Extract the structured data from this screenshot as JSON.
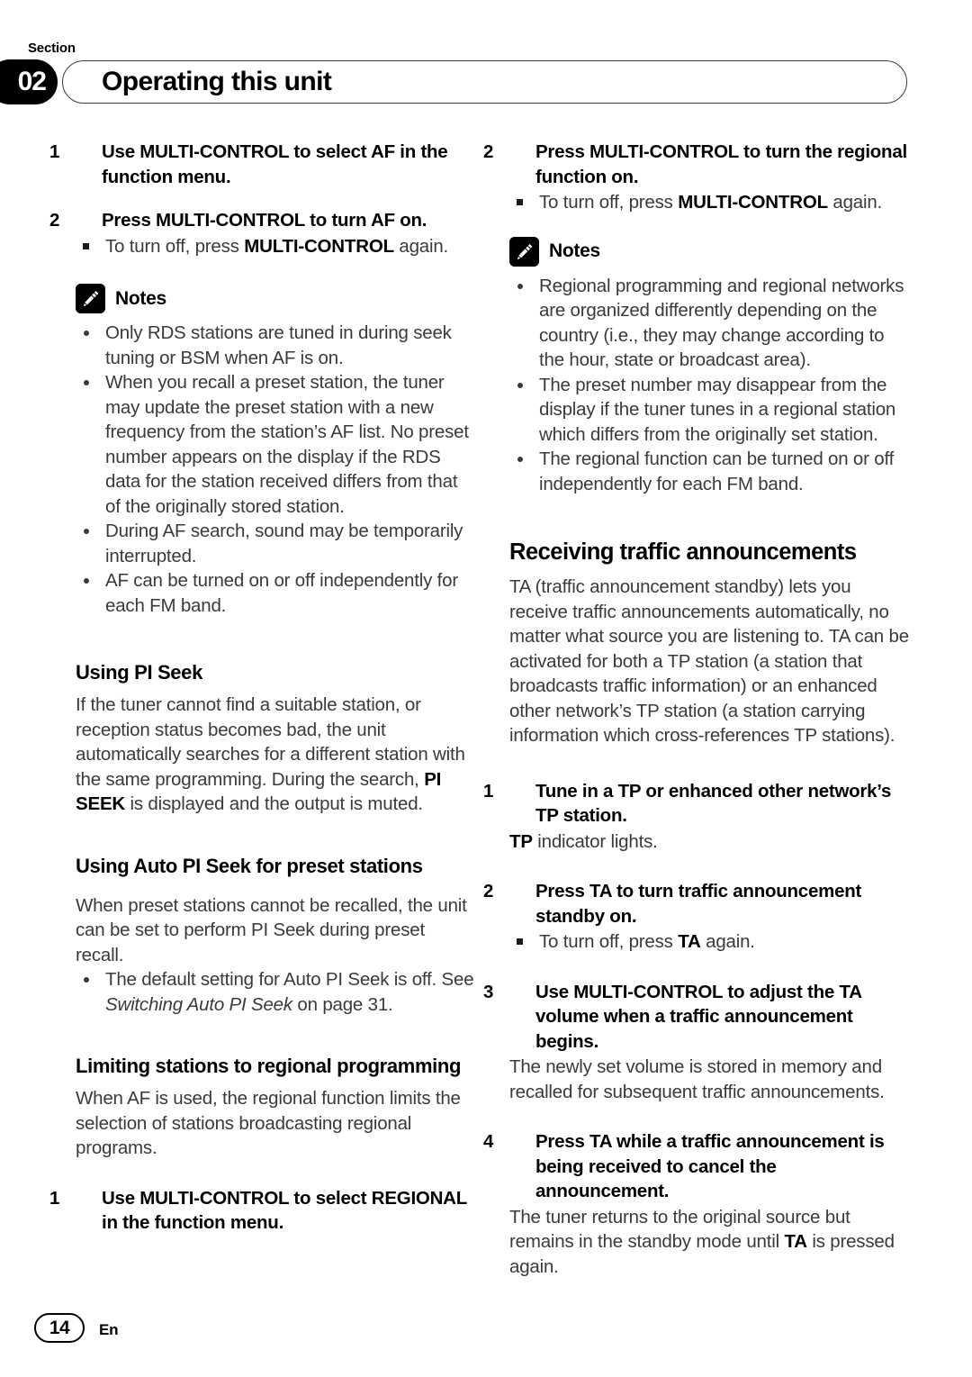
{
  "header": {
    "section_label": "Section",
    "section_number": "02",
    "title": "Operating this unit"
  },
  "footer": {
    "page_number": "14",
    "language_code": "En"
  },
  "icons": {
    "notes": "pencil-note-icon"
  },
  "left_column": {
    "step_af_1_num": "1",
    "step_af_1_text": "Use MULTI-CONTROL to select AF in the function menu.",
    "step_af_2_num": "2",
    "step_af_2_text": "Press MULTI-CONTROL to turn AF on.",
    "step_af_2_subbullet_pre": "To turn off, press ",
    "step_af_2_subbullet_bold": "MULTI-CONTROL",
    "step_af_2_subbullet_post": " again.",
    "notes_label": "Notes",
    "notes": [
      "Only RDS stations are tuned in during seek tuning or BSM when AF is on.",
      "When you recall a preset station, the tuner may update the preset station with a new frequency from the station’s AF list. No preset number appears on the display if the RDS data for the station received differs from that of the originally stored station.",
      "During AF search, sound may be temporarily interrupted.",
      "AF can be turned on or off independently for each FM band."
    ],
    "heading_pi_seek": "Using PI Seek",
    "pi_seek_body_pre": "If the tuner cannot find a suitable station, or reception status becomes bad, the unit automatically searches for a different station with the same programming. During the search, ",
    "pi_seek_body_bold": "PI SEEK",
    "pi_seek_body_post": " is displayed and the output is muted.",
    "heading_auto_pi_seek": "Using Auto PI Seek for preset stations",
    "auto_pi_seek_body": "When preset stations cannot be recalled, the unit can be set to perform PI Seek during preset recall.",
    "auto_pi_seek_note_pre": "The default setting for Auto PI Seek is off. See ",
    "auto_pi_seek_note_italic": "Switching Auto PI Seek",
    "auto_pi_seek_note_post": " on page 31.",
    "heading_limiting": "Limiting stations to regional programming",
    "limiting_body": "When AF is used, the regional function limits the selection of stations broadcasting regional programs.",
    "step_reg_1_num": "1",
    "step_reg_1_text": "Use MULTI-CONTROL to select REGIONAL in the function menu."
  },
  "right_column": {
    "step_reg_2_num": "2",
    "step_reg_2_text": "Press MULTI-CONTROL to turn the regional function on.",
    "step_reg_2_subbullet_pre": "To turn off, press ",
    "step_reg_2_subbullet_bold": "MULTI-CONTROL",
    "step_reg_2_subbullet_post": " again.",
    "notes_label": "Notes",
    "notes": [
      "Regional programming and regional networks are organized differently depending on the country (i.e., they may change according to the hour, state or broadcast area).",
      "The preset number may disappear from the display if the tuner tunes in a regional station which differs from the originally set station.",
      "The regional function can be turned on or off independently for each FM band."
    ],
    "heading_receiving_ta": "Receiving traffic announcements",
    "receiving_ta_body": "TA (traffic announcement standby) lets you receive traffic announcements automatically, no matter what source you are listening to. TA can be activated for both a TP station (a station that broadcasts traffic information) or an enhanced other network’s TP station (a station carrying information which cross-references TP stations).",
    "step_ta_1_num": "1",
    "step_ta_1_text": "Tune in a TP or enhanced other network’s TP station.",
    "step_ta_1_body_bold": "TP",
    "step_ta_1_body_post": " indicator lights.",
    "step_ta_2_num": "2",
    "step_ta_2_text": "Press TA to turn traffic announcement standby on.",
    "step_ta_2_subbullet_pre": "To turn off, press ",
    "step_ta_2_subbullet_bold": "TA",
    "step_ta_2_subbullet_post": " again.",
    "step_ta_3_num": "3",
    "step_ta_3_text": "Use MULTI-CONTROL to adjust the TA volume when a traffic announcement begins.",
    "step_ta_3_body": "The newly set volume is stored in memory and recalled for subsequent traffic announcements.",
    "step_ta_4_num": "4",
    "step_ta_4_text": "Press TA while a traffic announcement is being received to cancel the announcement.",
    "step_ta_4_body_pre": "The tuner returns to the original source but remains in the standby mode until ",
    "step_ta_4_body_bold": "TA",
    "step_ta_4_body_post": " is pressed again."
  }
}
